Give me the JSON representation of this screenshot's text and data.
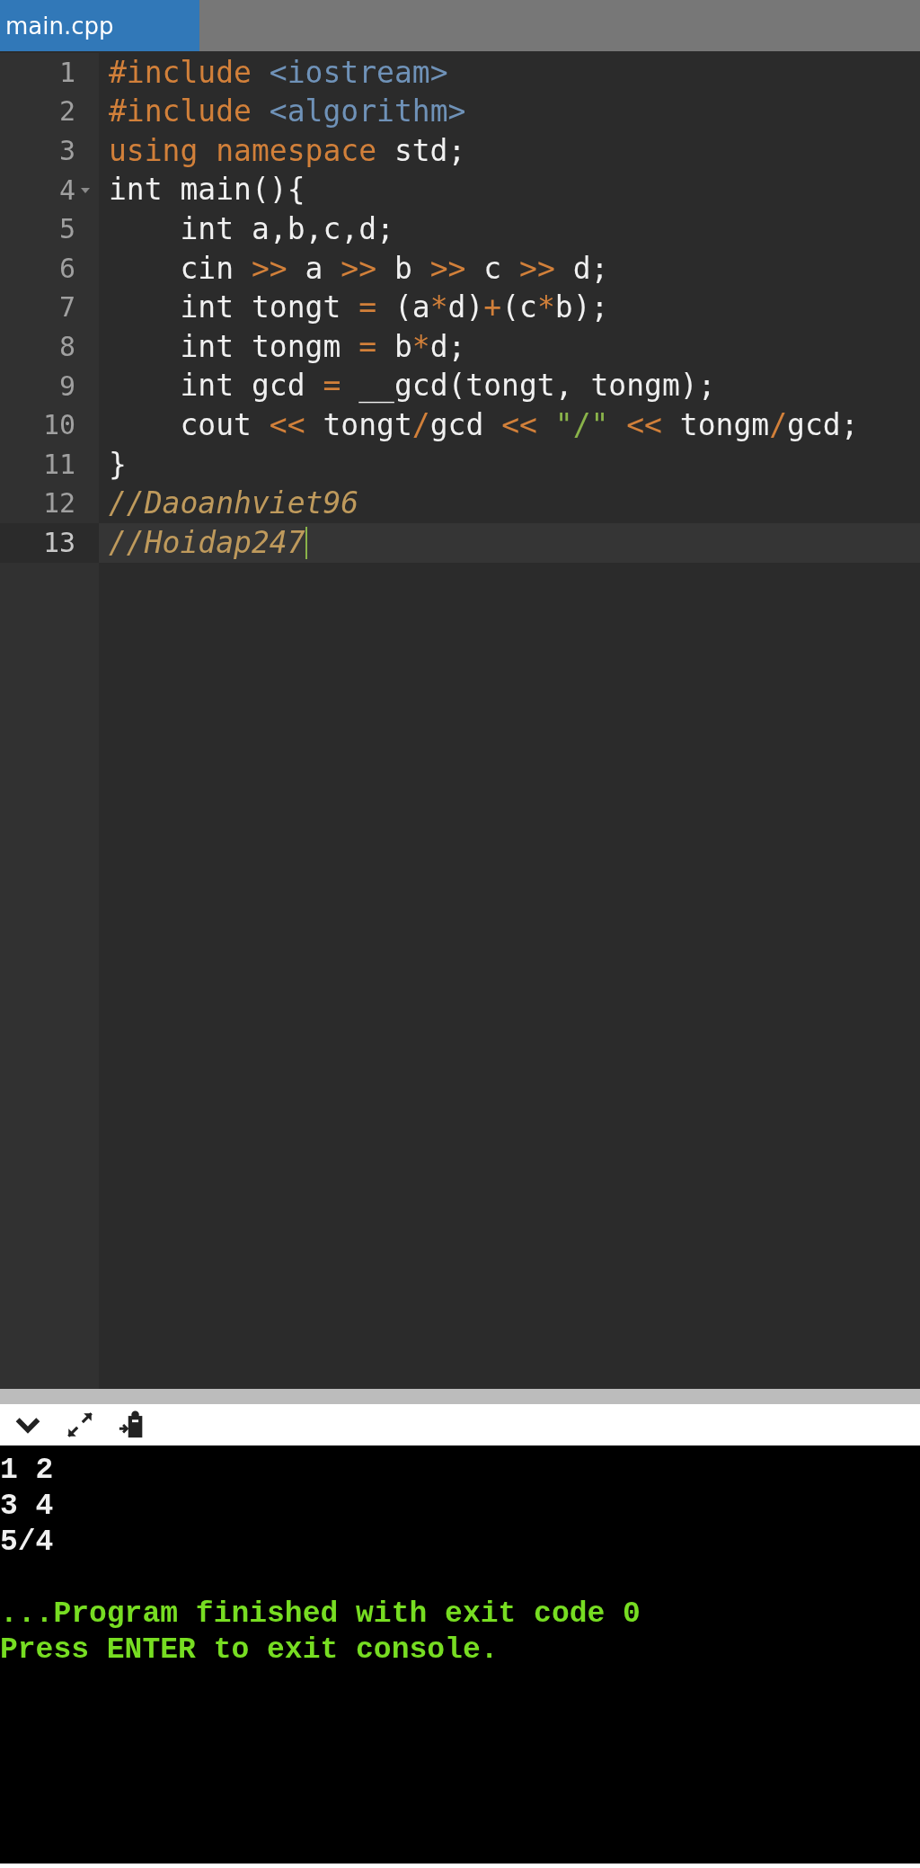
{
  "tabs": [
    {
      "label": "main.cpp",
      "selected": true
    }
  ],
  "editor": {
    "lines": [
      {
        "number": "1",
        "fold": false,
        "active": false,
        "tokens": [
          {
            "kind": "directive",
            "text": "#include"
          },
          {
            "kind": "header",
            "text": " <iostream>"
          }
        ]
      },
      {
        "number": "2",
        "fold": false,
        "active": false,
        "tokens": [
          {
            "kind": "directive",
            "text": "#include"
          },
          {
            "kind": "header",
            "text": " <algorithm>"
          }
        ]
      },
      {
        "number": "3",
        "fold": false,
        "active": false,
        "tokens": [
          {
            "kind": "keyword",
            "text": "using namespace"
          },
          {
            "kind": "plain",
            "text": " std;"
          }
        ]
      },
      {
        "number": "4",
        "fold": true,
        "active": false,
        "tokens": [
          {
            "kind": "plain",
            "text": "int main(){"
          }
        ]
      },
      {
        "number": "5",
        "fold": false,
        "active": false,
        "tokens": [
          {
            "kind": "plain",
            "text": "    int a,b,c,d;"
          }
        ]
      },
      {
        "number": "6",
        "fold": false,
        "active": false,
        "tokens": [
          {
            "kind": "plain",
            "text": "    cin "
          },
          {
            "kind": "operator",
            "text": ">>"
          },
          {
            "kind": "plain",
            "text": " a "
          },
          {
            "kind": "operator",
            "text": ">>"
          },
          {
            "kind": "plain",
            "text": " b "
          },
          {
            "kind": "operator",
            "text": ">>"
          },
          {
            "kind": "plain",
            "text": " c "
          },
          {
            "kind": "operator",
            "text": ">>"
          },
          {
            "kind": "plain",
            "text": " d;"
          }
        ]
      },
      {
        "number": "7",
        "fold": false,
        "active": false,
        "tokens": [
          {
            "kind": "plain",
            "text": "    int tongt "
          },
          {
            "kind": "operator",
            "text": "="
          },
          {
            "kind": "plain",
            "text": " (a"
          },
          {
            "kind": "operator",
            "text": "*"
          },
          {
            "kind": "plain",
            "text": "d)"
          },
          {
            "kind": "operator",
            "text": "+"
          },
          {
            "kind": "plain",
            "text": "(c"
          },
          {
            "kind": "operator",
            "text": "*"
          },
          {
            "kind": "plain",
            "text": "b);"
          }
        ]
      },
      {
        "number": "8",
        "fold": false,
        "active": false,
        "tokens": [
          {
            "kind": "plain",
            "text": "    int tongm "
          },
          {
            "kind": "operator",
            "text": "="
          },
          {
            "kind": "plain",
            "text": " b"
          },
          {
            "kind": "operator",
            "text": "*"
          },
          {
            "kind": "plain",
            "text": "d;"
          }
        ]
      },
      {
        "number": "9",
        "fold": false,
        "active": false,
        "tokens": [
          {
            "kind": "plain",
            "text": "    int gcd "
          },
          {
            "kind": "operator",
            "text": "="
          },
          {
            "kind": "plain",
            "text": " __gcd(tongt, tongm);"
          }
        ]
      },
      {
        "number": "10",
        "fold": false,
        "active": false,
        "tokens": [
          {
            "kind": "plain",
            "text": "    cout "
          },
          {
            "kind": "operator",
            "text": "<<"
          },
          {
            "kind": "plain",
            "text": " tongt"
          },
          {
            "kind": "operator",
            "text": "/"
          },
          {
            "kind": "plain",
            "text": "gcd "
          },
          {
            "kind": "operator",
            "text": "<<"
          },
          {
            "kind": "string",
            "text": " \"/\""
          },
          {
            "kind": "operator",
            "text": " <<"
          },
          {
            "kind": "plain",
            "text": " tongm"
          },
          {
            "kind": "operator",
            "text": "/"
          },
          {
            "kind": "plain",
            "text": "gcd;"
          }
        ]
      },
      {
        "number": "11",
        "fold": false,
        "active": false,
        "tokens": [
          {
            "kind": "plain",
            "text": "}"
          }
        ]
      },
      {
        "number": "12",
        "fold": false,
        "active": false,
        "tokens": [
          {
            "kind": "comment",
            "text": "//Daoanhviet96"
          }
        ]
      },
      {
        "number": "13",
        "fold": false,
        "active": true,
        "tokens": [
          {
            "kind": "comment",
            "text": "//Hoidap247"
          }
        ]
      }
    ]
  },
  "console": {
    "lines": [
      {
        "kind": "input",
        "text": "1 2"
      },
      {
        "kind": "input",
        "text": "3 4"
      },
      {
        "kind": "output",
        "text": "5/4"
      },
      {
        "kind": "status",
        "text": "...Program finished with exit code 0"
      },
      {
        "kind": "status",
        "text": "Press ENTER to exit console."
      }
    ]
  }
}
